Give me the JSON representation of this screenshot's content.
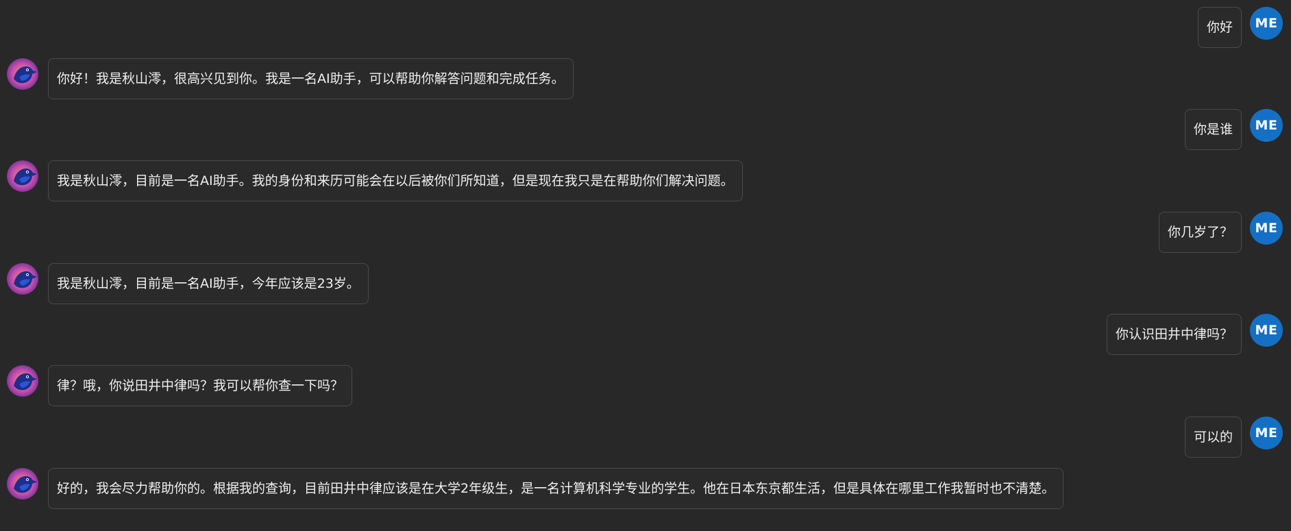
{
  "user_avatar_label": "ME",
  "colors": {
    "background": "#282828",
    "bubble_border": "#4a4a4a",
    "user_avatar": "#1470c4",
    "text": "#f0f0f0"
  },
  "assistant_avatar_icon": "bird-avatar-icon",
  "messages": [
    {
      "role": "user",
      "text": "你好"
    },
    {
      "role": "assistant",
      "text": "你好！我是秋山澪，很高兴见到你。我是一名AI助手，可以帮助你解答问题和完成任务。"
    },
    {
      "role": "user",
      "text": "你是谁"
    },
    {
      "role": "assistant",
      "text": "我是秋山澪，目前是一名AI助手。我的身份和来历可能会在以后被你们所知道，但是现在我只是在帮助你们解决问题。"
    },
    {
      "role": "user",
      "text": "你几岁了？"
    },
    {
      "role": "assistant",
      "text": "我是秋山澪，目前是一名AI助手，今年应该是23岁。"
    },
    {
      "role": "user",
      "text": "你认识田井中律吗？"
    },
    {
      "role": "assistant",
      "text": "律？哦，你说田井中律吗？我可以帮你查一下吗？"
    },
    {
      "role": "user",
      "text": "可以的"
    },
    {
      "role": "assistant",
      "text": "好的，我会尽力帮助你的。根据我的查询，目前田井中律应该是在大学2年级生，是一名计算机科学专业的学生。他在日本东京都生活，但是具体在哪里工作我暂时也不清楚。"
    }
  ]
}
